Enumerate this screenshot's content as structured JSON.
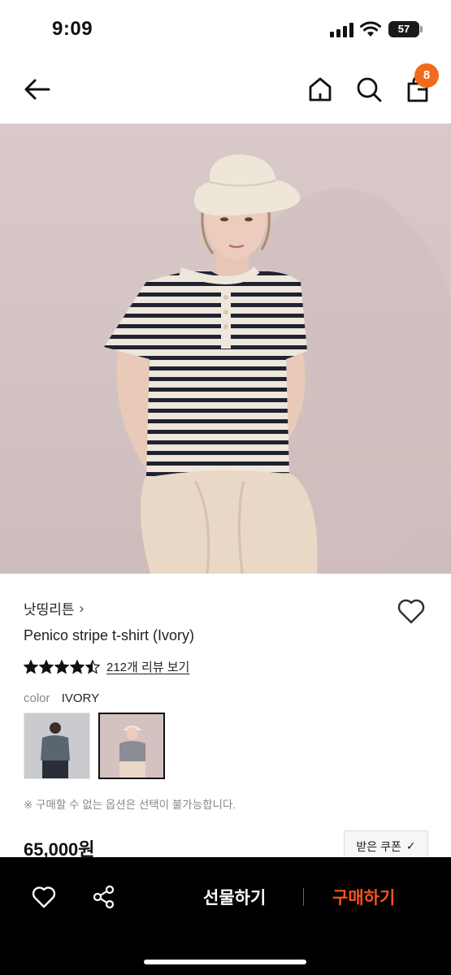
{
  "status_bar": {
    "time": "9:09",
    "battery": "57",
    "battery_level": 0.57
  },
  "nav": {
    "back_icon": "arrow-left-icon",
    "home_icon": "home-icon",
    "search_icon": "search-icon",
    "bag_icon": "shopping-bag-icon",
    "cart_count": "8"
  },
  "product": {
    "brand": "낫띵리튼",
    "brand_chevron": "›",
    "title": "Penico stripe t-shirt (Ivory)",
    "rating": 4.5,
    "review_link": "212개 리뷰 보기",
    "color_label": "color",
    "color_value": "IVORY",
    "option_note": "※ 구매할 수 없는 옵션은 선택이 불가능합니다.",
    "price": "65,000원",
    "coupon_label": "받은 쿠폰",
    "coupon_check": "✓"
  },
  "bottom_bar": {
    "wish_icon": "heart-icon",
    "share_icon": "share-icon",
    "gift_label": "선물하기",
    "buy_label": "구매하기"
  },
  "colors": {
    "accent": "#f26a1b",
    "buy": "#f2541b",
    "bottom_bg": "#000000"
  }
}
